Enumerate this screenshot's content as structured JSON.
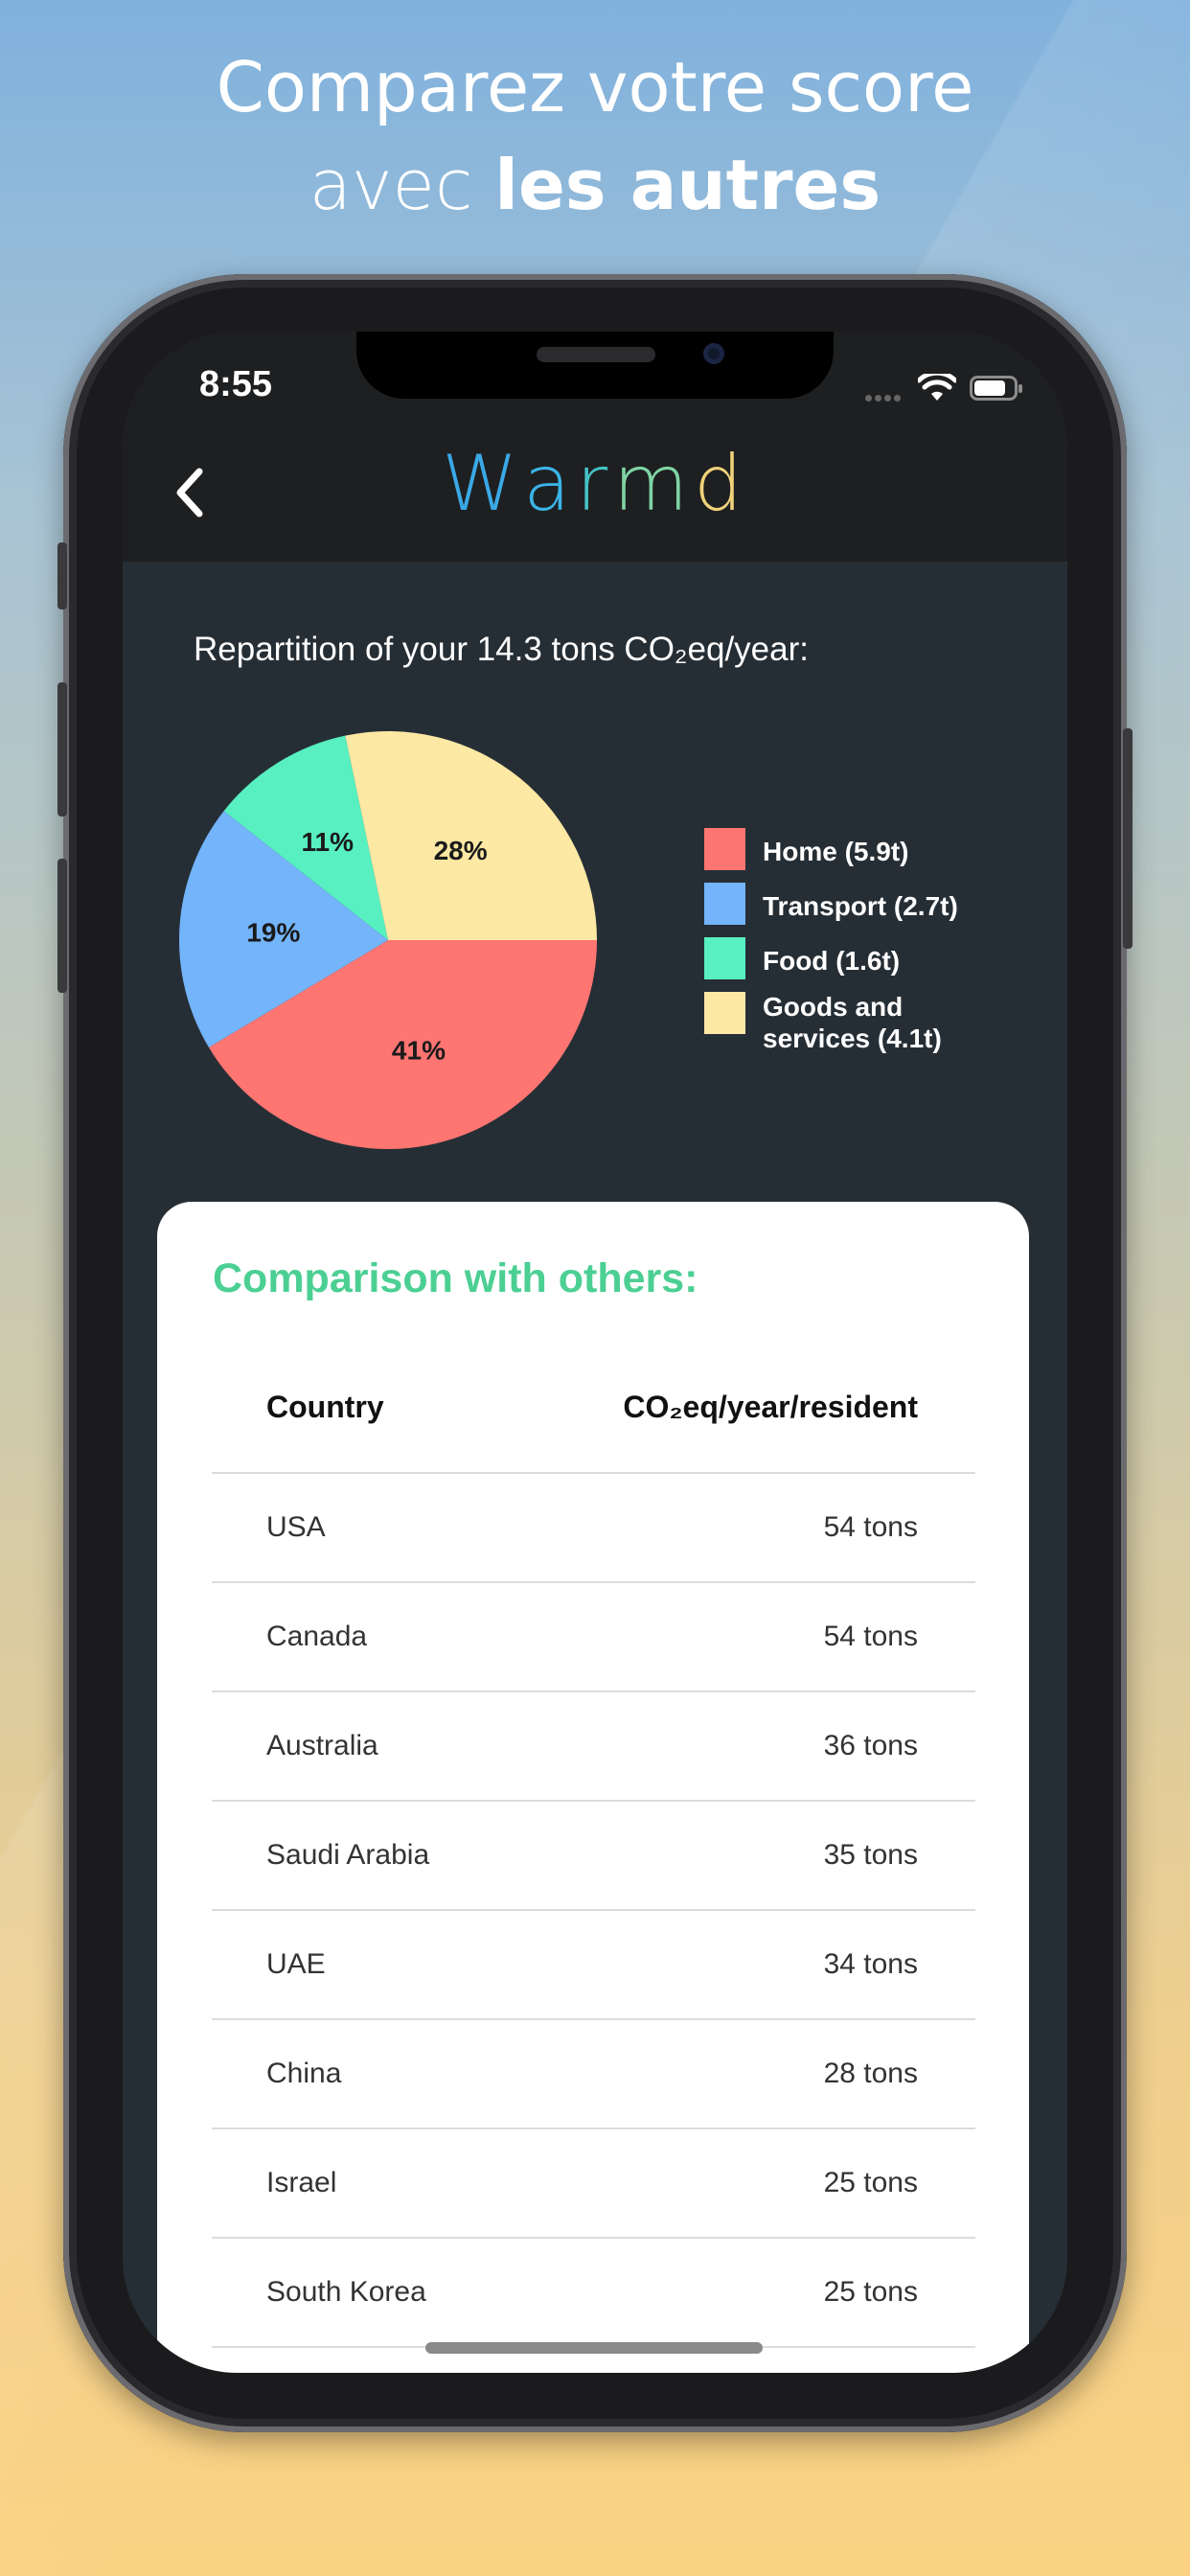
{
  "promo": {
    "line1": "Comparez votre score",
    "line2_prefix": "avec ",
    "line2_bold": "les autres"
  },
  "status_bar": {
    "time": "8:55"
  },
  "app": {
    "title_letters": [
      "W",
      "a",
      "r",
      "m",
      "d"
    ],
    "title_colors": [
      "#3aa9e6",
      "#3ab3e6",
      "#45c3c7",
      "#7ed4a3",
      "#f0d27a"
    ]
  },
  "repartition": {
    "title": "Repartition of your 14.3 tons CO₂eq/year:"
  },
  "chart_data": {
    "type": "pie",
    "slices": [
      {
        "label": "Home (5.9t)",
        "value": 41,
        "display": "41%",
        "color": "#ff7571"
      },
      {
        "label": "Transport (2.7t)",
        "value": 19,
        "display": "19%",
        "color": "#73b4fb"
      },
      {
        "label": "Food (1.6t)",
        "value": 11,
        "display": "11%",
        "color": "#58f0c0"
      },
      {
        "label": "Goods and services (4.1t)",
        "value": 28,
        "display": "28%",
        "color": "#fde8a4"
      }
    ],
    "legend_position": "right"
  },
  "comparison": {
    "title": "Comparison with others:",
    "headers": {
      "country": "Country",
      "value": "CO₂eq/year/resident"
    },
    "rows": [
      {
        "country": "USA",
        "value": "54 tons"
      },
      {
        "country": "Canada",
        "value": "54 tons"
      },
      {
        "country": "Australia",
        "value": "36 tons"
      },
      {
        "country": "Saudi Arabia",
        "value": "35 tons"
      },
      {
        "country": "UAE",
        "value": "34 tons"
      },
      {
        "country": "China",
        "value": "28 tons"
      },
      {
        "country": "Israel",
        "value": "25 tons"
      },
      {
        "country": "South Korea",
        "value": "25 tons"
      }
    ]
  },
  "icons": {
    "back": "chevron-left-icon",
    "wifi": "wifi-icon",
    "battery": "battery-icon",
    "signal": "cellular-signal-icon"
  }
}
